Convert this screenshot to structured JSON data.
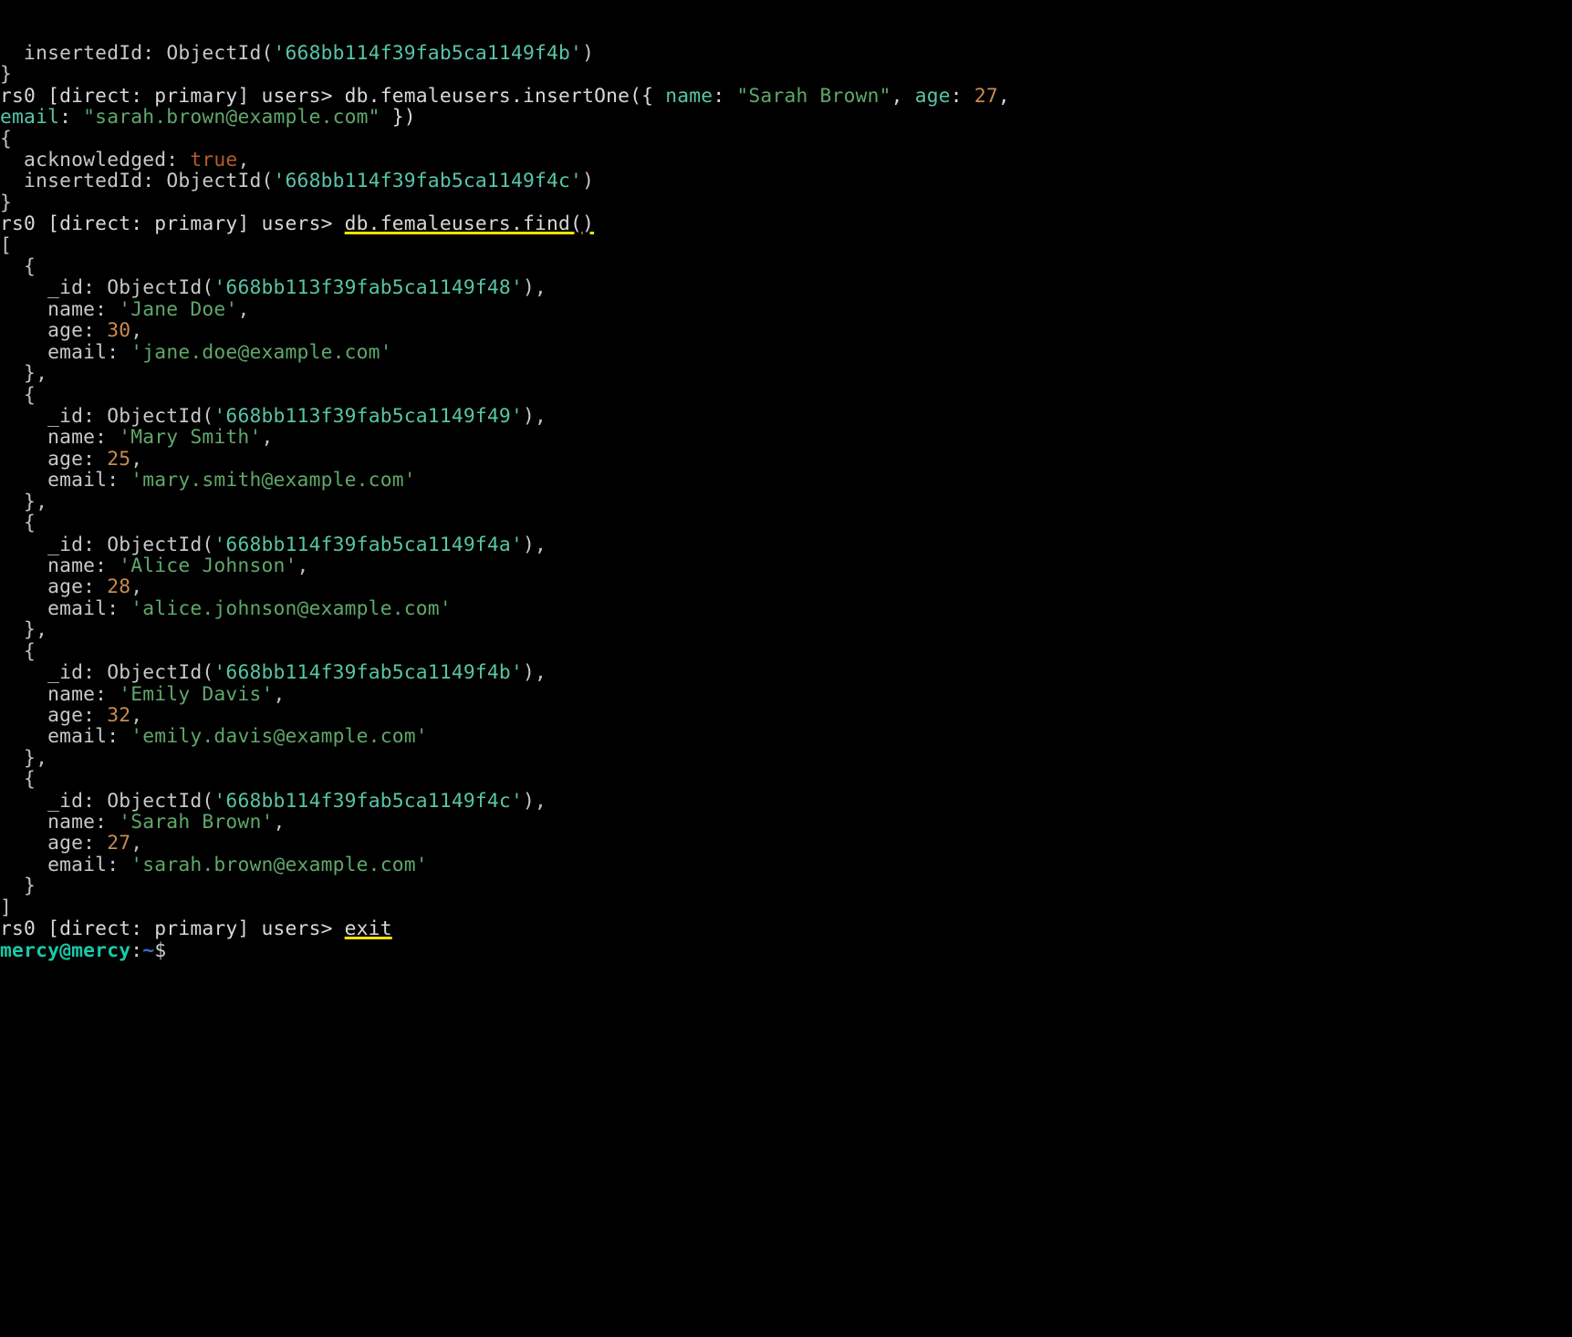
{
  "top_output_line1_key": "  insertedId: ",
  "top_output_line1_funcL": "ObjectId(",
  "top_output_line1_oid": "'668bb114f39fab5ca1149f4b'",
  "top_output_line1_funcR": ")",
  "top_output_close": "}",
  "insert_prompt": "rs0 [direct: primary] users> ",
  "insert_cmd_pre": "db.femaleusers.insertOne({ ",
  "insert_kv_name_k": "name",
  "insert_kv_colon": ": ",
  "insert_kv_name_v": "\"Sarah Brown\"",
  "insert_comma": ", ",
  "insert_kv_age_k": "age",
  "insert_kv_age_v": "27",
  "insert_close1": ",",
  "insert_line2_k": "email",
  "insert_line2_v": "\"sarah.brown@example.com\"",
  "insert_line2_close": " })",
  "ack_open": "{",
  "ack_line1_k": "  acknowledged: ",
  "ack_line1_v": "true",
  "ack_line1_comma": ",",
  "ack_line2_k": "  insertedId: ",
  "ack_line2_funcL": "ObjectId(",
  "ack_line2_oid": "'668bb114f39fab5ca1149f4c'",
  "ack_line2_funcR": ")",
  "ack_close": "}",
  "find_prompt": "rs0 [direct: primary] users> ",
  "find_cmd": "db.femaleusers.find()",
  "arr_open": "[",
  "arr_close": "]",
  "docs": [
    {
      "oid": "'668bb113f39fab5ca1149f48'",
      "name": "'Jane Doe'",
      "age": "30",
      "email": "'jane.doe@example.com'"
    },
    {
      "oid": "'668bb113f39fab5ca1149f49'",
      "name": "'Mary Smith'",
      "age": "25",
      "email": "'mary.smith@example.com'"
    },
    {
      "oid": "'668bb114f39fab5ca1149f4a'",
      "name": "'Alice Johnson'",
      "age": "28",
      "email": "'alice.johnson@example.com'"
    },
    {
      "oid": "'668bb114f39fab5ca1149f4b'",
      "name": "'Emily Davis'",
      "age": "32",
      "email": "'emily.davis@example.com'"
    },
    {
      "oid": "'668bb114f39fab5ca1149f4c'",
      "name": "'Sarah Brown'",
      "age": "27",
      "email": "'sarah.brown@example.com'"
    }
  ],
  "doc_open": "  {",
  "doc_id_prefix": "    _id: ",
  "doc_id_funcL": "ObjectId(",
  "doc_id_funcR": ")",
  "doc_id_end": ",",
  "doc_name_prefix": "    name: ",
  "doc_name_end": ",",
  "doc_age_prefix": "    age: ",
  "doc_age_end": ",",
  "doc_email_prefix": "    email: ",
  "doc_close_mid": "  },",
  "doc_close_last": "  }",
  "exit_prompt": "rs0 [direct: primary] users> ",
  "exit_cmd": "exit",
  "shell_user": "mercy@mercy",
  "shell_colon": ":",
  "shell_path": "~",
  "shell_dollar": "$ "
}
